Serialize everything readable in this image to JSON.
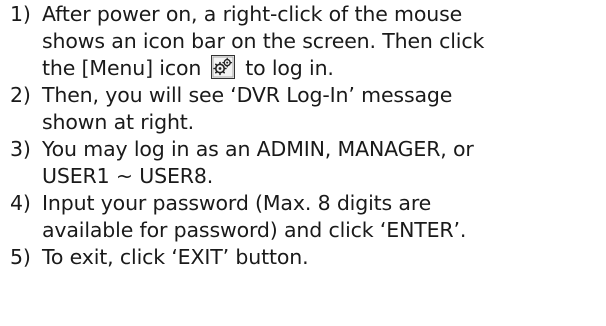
{
  "steps": [
    {
      "number": "1)",
      "lines": [
        "After power on, a right-click of the mouse",
        "shows an icon bar on the screen. Then click",
        "the [Menu] icon",
        "to log in."
      ],
      "icon": "menu-gear-icon"
    },
    {
      "number": "2)",
      "lines": [
        "Then, you will see ‘DVR Log-In’ message",
        "shown at right."
      ]
    },
    {
      "number": "3)",
      "lines": [
        "You may log in as an ADMIN, MANAGER, or",
        "USER1 ~ USER8."
      ]
    },
    {
      "number": "4)",
      "lines": [
        "Input your password (Max. 8 digits are",
        "available for password) and click ‘ENTER’."
      ]
    },
    {
      "number": "5)",
      "lines": [
        "To exit, click ‘EXIT’ button."
      ]
    }
  ]
}
